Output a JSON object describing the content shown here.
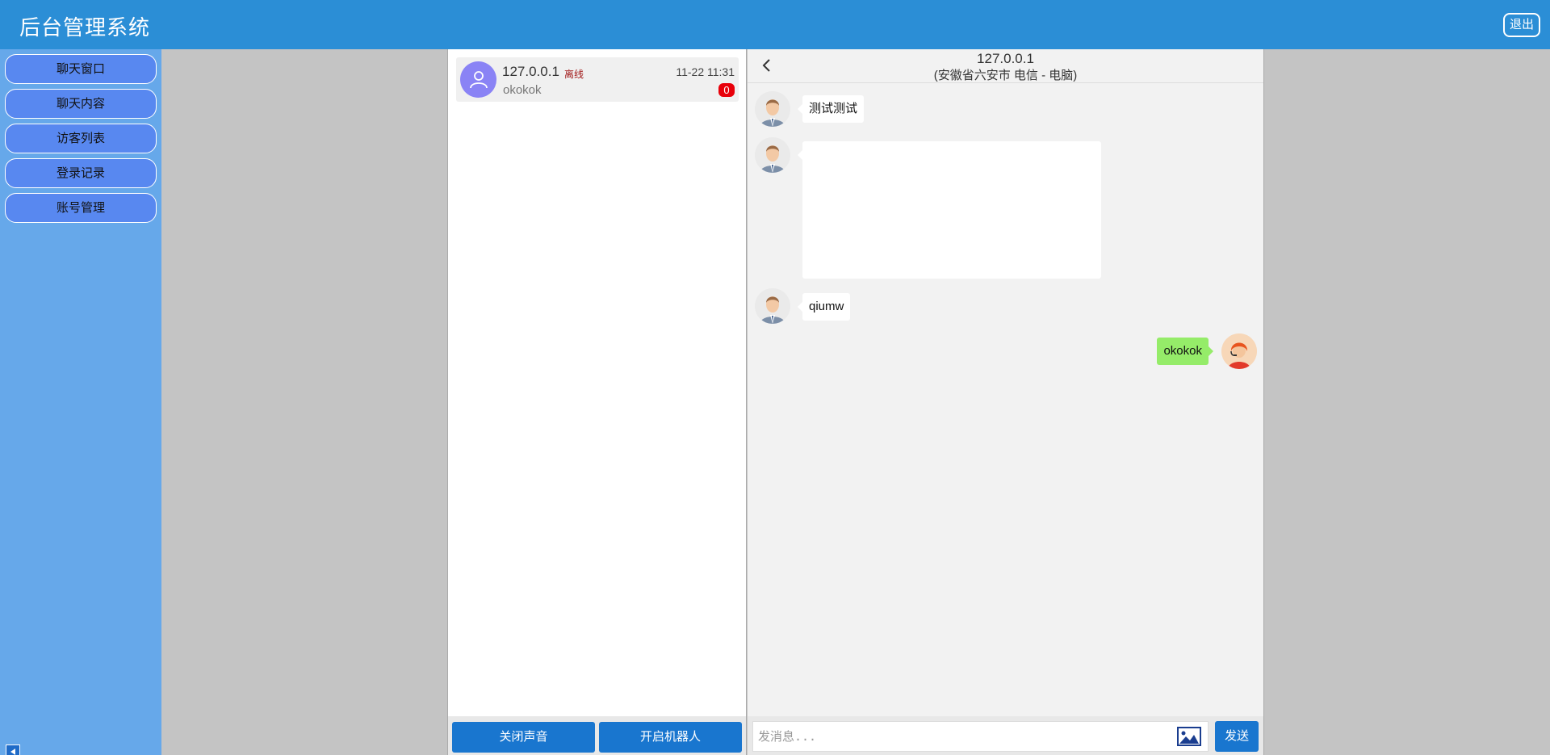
{
  "header": {
    "title": "后台管理系统",
    "logout_label": "退出"
  },
  "sidebar": {
    "items": [
      {
        "label": "聊天窗口"
      },
      {
        "label": "聊天内容"
      },
      {
        "label": "访客列表"
      },
      {
        "label": "登录记录"
      },
      {
        "label": "账号管理"
      }
    ],
    "collapse_icon": "triangle-left-icon"
  },
  "visitor_list": {
    "conversations": [
      {
        "ip": "127.0.0.1",
        "status": "离线",
        "time": "11-22 11:31",
        "preview": "okokok",
        "unread": "0"
      }
    ],
    "buttons": {
      "sound": "关闭声音",
      "robot": "开启机器人"
    }
  },
  "chat": {
    "ip": "127.0.0.1",
    "location": "(安徽省六安市 电信 - 电脑)",
    "messages": [
      {
        "from": "visitor",
        "type": "text",
        "text": "测试测试"
      },
      {
        "from": "visitor",
        "type": "image"
      },
      {
        "from": "visitor",
        "type": "text",
        "text": "qiumw"
      },
      {
        "from": "agent",
        "type": "text",
        "text": "okokok"
      }
    ],
    "input_placeholder": "发消息...",
    "send_label": "发送"
  },
  "colors": {
    "header": "#2b8ed6",
    "sidebar": "#66a8ea",
    "nav_button": "#5888f0",
    "primary_button": "#1976cf",
    "agent_bubble": "#95ec69",
    "badge": "#e8000a"
  }
}
